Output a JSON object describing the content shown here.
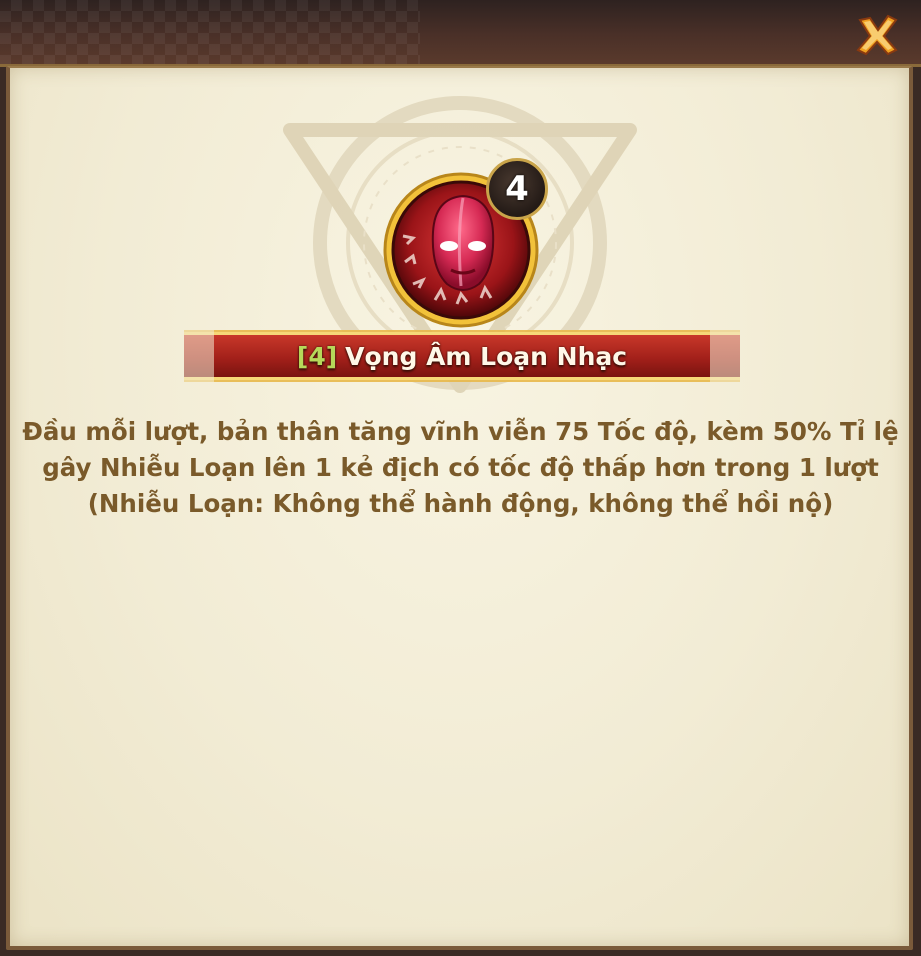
{
  "window": {
    "close_icon": "close-x-icon",
    "accent_color": "#c9a44a"
  },
  "skill": {
    "badge_level": "4",
    "name_level_tag": "[4]",
    "name": "Vọng Âm Loạn Nhạc",
    "icon": "red-masked-face-icon",
    "description_lines": [
      "Đầu mỗi lượt, bản thân tăng vĩnh viễn 75 Tốc độ, kèm 50% Tỉ lệ",
      "gây Nhiễu Loạn lên 1 kẻ địch có tốc độ thấp hơn trong 1 lượt",
      "(Nhiễu Loạn: Không thể hành động, không thể hồi nộ)"
    ],
    "text_color": "#7a5a2a",
    "ribbon_color": "#a8281c"
  }
}
